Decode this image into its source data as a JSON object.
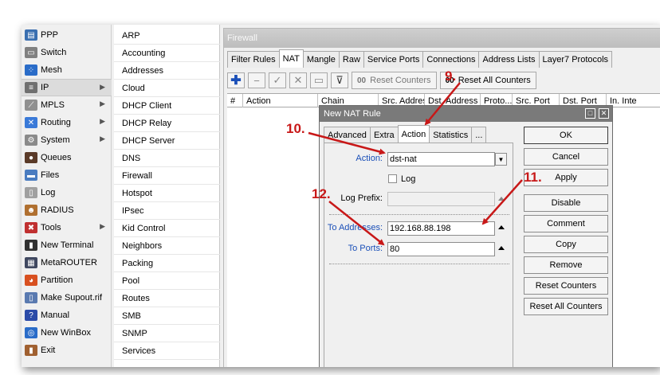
{
  "menu1": [
    {
      "label": "PPP",
      "icon": "ppp-icon",
      "color": "#3a6fb0",
      "glyph": "▤"
    },
    {
      "label": "Switch",
      "icon": "switch-icon",
      "color": "#808080",
      "glyph": "▭"
    },
    {
      "label": "Mesh",
      "icon": "mesh-icon",
      "color": "#2a6cc8",
      "glyph": "⁘"
    },
    {
      "label": "IP",
      "icon": "ip-icon",
      "color": "#707070",
      "glyph": "≡",
      "submenu": true,
      "selected": true
    },
    {
      "label": "MPLS",
      "icon": "mpls-icon",
      "color": "#909090",
      "glyph": "⟋",
      "submenu": true
    },
    {
      "label": "Routing",
      "icon": "routing-icon",
      "color": "#3a7ad8",
      "glyph": "✕",
      "submenu": true
    },
    {
      "label": "System",
      "icon": "system-icon",
      "color": "#8a8a8a",
      "glyph": "⚙",
      "submenu": true
    },
    {
      "label": "Queues",
      "icon": "queues-icon",
      "color": "#5a3a28",
      "glyph": "●"
    },
    {
      "label": "Files",
      "icon": "files-icon",
      "color": "#4a7cc0",
      "glyph": "▬"
    },
    {
      "label": "Log",
      "icon": "log-icon",
      "color": "#a0a0a0",
      "glyph": "▯"
    },
    {
      "label": "RADIUS",
      "icon": "radius-icon",
      "color": "#b07030",
      "glyph": "☻"
    },
    {
      "label": "Tools",
      "icon": "tools-icon",
      "color": "#c03030",
      "glyph": "✖",
      "submenu": true
    },
    {
      "label": "New Terminal",
      "icon": "terminal-icon",
      "color": "#303030",
      "glyph": "▮"
    },
    {
      "label": "MetaROUTER",
      "icon": "metarouter-icon",
      "color": "#404860",
      "glyph": "▦"
    },
    {
      "label": "Partition",
      "icon": "partition-icon",
      "color": "#d85020",
      "glyph": "◕"
    },
    {
      "label": "Make Supout.rif",
      "icon": "supout-icon",
      "color": "#5a7ab0",
      "glyph": "▯"
    },
    {
      "label": "Manual",
      "icon": "manual-icon",
      "color": "#2a4aa8",
      "glyph": "?"
    },
    {
      "label": "New WinBox",
      "icon": "winbox-icon",
      "color": "#2a6cc8",
      "glyph": "◎"
    },
    {
      "label": "Exit",
      "icon": "exit-icon",
      "color": "#a06030",
      "glyph": "▮"
    }
  ],
  "menu2": [
    "ARP",
    "Accounting",
    "Addresses",
    "Cloud",
    "DHCP Client",
    "DHCP Relay",
    "DHCP Server",
    "DNS",
    "Firewall",
    "Hotspot",
    "IPsec",
    "Kid Control",
    "Neighbors",
    "Packing",
    "Pool",
    "Routes",
    "SMB",
    "SNMP",
    "Services"
  ],
  "firewall": {
    "title": "Firewall",
    "tabs": [
      "Filter Rules",
      "NAT",
      "Mangle",
      "Raw",
      "Service Ports",
      "Connections",
      "Address Lists",
      "Layer7 Protocols"
    ],
    "active_tab": 1,
    "toolbar": {
      "reset_counters": "Reset Counters",
      "reset_all_counters": "Reset All Counters",
      "oo": "00"
    },
    "columns": [
      "#",
      "Action",
      "Chain",
      "Src. Address",
      "Dst. Address",
      "Proto...",
      "Src. Port",
      "Dst. Port",
      "In. Inte"
    ]
  },
  "dialog": {
    "title": "New NAT Rule",
    "tabs": [
      "Advanced",
      "Extra",
      "Action",
      "Statistics",
      "..."
    ],
    "active_tab": 2,
    "action_label": "Action:",
    "action_value": "dst-nat",
    "log_label": "Log",
    "log_prefix_label": "Log Prefix:",
    "to_addresses_label": "To Addresses:",
    "to_addresses_value": "192.168.88.198",
    "to_ports_label": "To Ports:",
    "to_ports_value": "80",
    "buttons": [
      "OK",
      "Cancel",
      "Apply",
      "Disable",
      "Comment",
      "Copy",
      "Remove",
      "Reset Counters",
      "Reset All Counters"
    ]
  },
  "annotations": [
    "9.",
    "10.",
    "11.",
    "12."
  ],
  "colors": {
    "annotation": "#c81818",
    "link_blue": "#1a4fb8"
  }
}
